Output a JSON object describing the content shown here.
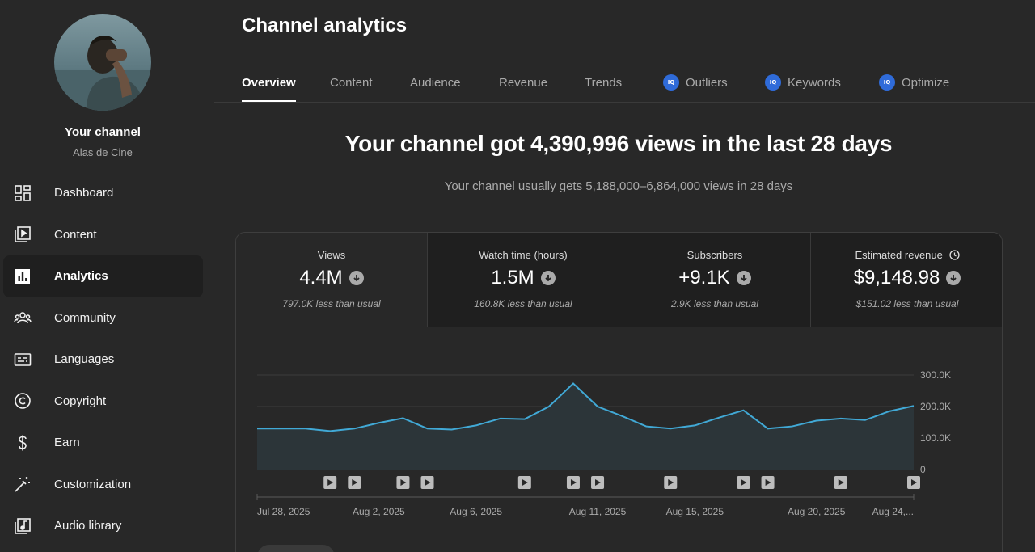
{
  "sidebar": {
    "channel_name": "Your channel",
    "channel_handle": "Alas de Cine",
    "items": [
      {
        "label": "Dashboard",
        "icon": "dashboard-icon"
      },
      {
        "label": "Content",
        "icon": "content-icon"
      },
      {
        "label": "Analytics",
        "icon": "analytics-icon",
        "active": true
      },
      {
        "label": "Community",
        "icon": "community-icon"
      },
      {
        "label": "Languages",
        "icon": "languages-icon"
      },
      {
        "label": "Copyright",
        "icon": "copyright-icon"
      },
      {
        "label": "Earn",
        "icon": "dollar-icon"
      },
      {
        "label": "Customization",
        "icon": "magic-wand-icon"
      },
      {
        "label": "Audio library",
        "icon": "audio-library-icon"
      }
    ]
  },
  "header": {
    "title": "Channel analytics",
    "tabs": [
      {
        "label": "Overview",
        "active": true
      },
      {
        "label": "Content"
      },
      {
        "label": "Audience"
      },
      {
        "label": "Revenue"
      },
      {
        "label": "Trends"
      },
      {
        "label": "Outliers",
        "badge": "IQ"
      },
      {
        "label": "Keywords",
        "badge": "IQ"
      },
      {
        "label": "Optimize",
        "badge": "IQ"
      }
    ]
  },
  "summary": {
    "headline": "Your channel got 4,390,996 views in the last 28 days",
    "subline": "Your channel usually gets 5,188,000–6,864,000 views in 28 days"
  },
  "metrics": [
    {
      "label": "Views",
      "value": "4.4M",
      "sub": "797.0K less than usual",
      "active": true
    },
    {
      "label": "Watch time (hours)",
      "value": "1.5M",
      "sub": "160.8K less than usual"
    },
    {
      "label": "Subscribers",
      "value": "+9.1K",
      "sub": "2.9K less than usual"
    },
    {
      "label": "Estimated revenue",
      "value": "$9,148.98",
      "sub": "$151.02 less than usual",
      "has_clock": true
    }
  ],
  "colors": {
    "line": "#41a9d6",
    "fill": "#2c3539",
    "badge": "#2f6bd9"
  },
  "chart_data": {
    "type": "area",
    "y_ticks": [
      "300.0K",
      "200.0K",
      "100.0K",
      "0"
    ],
    "ylim": [
      0,
      300000
    ],
    "x_labels": [
      "Jul 28, 2025",
      "Aug 2, 2025",
      "Aug 6, 2025",
      "Aug 11, 2025",
      "Aug 15, 2025",
      "Aug 20, 2025",
      "Aug 24,..."
    ],
    "x_label_days": [
      0,
      5,
      9,
      14,
      18,
      23,
      27
    ],
    "values": [
      130000,
      130000,
      130000,
      122000,
      130000,
      148000,
      163000,
      130000,
      127000,
      140000,
      162000,
      160000,
      200000,
      273000,
      200000,
      170000,
      137000,
      130000,
      140000,
      165000,
      188000,
      130000,
      137000,
      155000,
      162000,
      157000,
      185000,
      202000
    ],
    "upload_days": [
      3,
      4,
      6,
      7,
      11,
      13,
      14,
      17,
      20,
      21,
      24,
      27
    ],
    "grid": true
  }
}
